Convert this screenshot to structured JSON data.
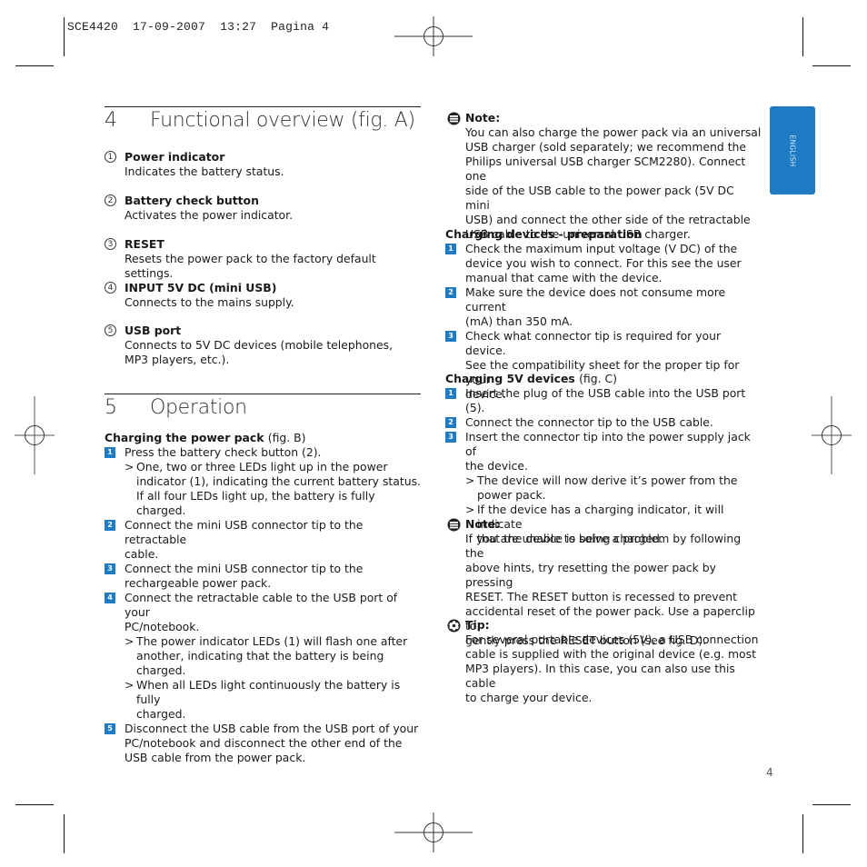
{
  "print_slug": {
    "job": "SCE4420",
    "date": "17-09-2007",
    "time": "13:27",
    "page_label": "Pagina 4"
  },
  "language_tab": {
    "label": "ENGLISH",
    "color": "#1e7bc4"
  },
  "page_number": "4",
  "sections": {
    "functional_overview": {
      "number": "4",
      "title": "Functional overview (fig. A)",
      "items": [
        {
          "marker": "1",
          "label": "Power indicator",
          "description": "Indicates the battery status."
        },
        {
          "marker": "2",
          "label": "Battery check button",
          "description": "Activates the power indicator."
        },
        {
          "marker": "3",
          "label": "RESET",
          "description": "Resets the power pack to the factory default settings."
        },
        {
          "marker": "4",
          "label": "INPUT 5V DC (mini USB)",
          "description": "Connects to the mains supply."
        },
        {
          "marker": "5",
          "label": "USB port",
          "description_lines": [
            "Connects to 5V DC devices (mobile telephones,",
            "MP3 players, etc.)."
          ]
        }
      ]
    },
    "operation": {
      "number": "5",
      "title": "Operation",
      "charging_power_pack": {
        "heading": "Charging the power pack",
        "heading_ref": "(fig. B)",
        "steps": [
          {
            "marker": "1",
            "lines": [
              "Press the battery check button (2)."
            ],
            "results": [
              {
                "lines": [
                  "One, two or three LEDs light up in the power",
                  "indicator (1), indicating the current battery status.",
                  "If all four LEDs light up, the battery is fully charged."
                ]
              }
            ]
          },
          {
            "marker": "2",
            "lines": [
              "Connect the mini USB connector tip to the retractable",
              "cable."
            ]
          },
          {
            "marker": "3",
            "lines": [
              "Connect the mini USB connector tip to the",
              "rechargeable power pack."
            ]
          },
          {
            "marker": "4",
            "lines": [
              "Connect the retractable cable to the USB port of your",
              "PC/notebook."
            ],
            "results": [
              {
                "lines": [
                  "The power indicator LEDs (1) will flash one after",
                  "another, indicating that the battery is being charged."
                ]
              },
              {
                "lines": [
                  "When all LEDs light continuously the battery is fully",
                  "charged."
                ]
              }
            ]
          },
          {
            "marker": "5",
            "lines": [
              "Disconnect the USB cable from the USB port of your",
              "PC/notebook and disconnect the other end of the",
              "USB cable from the power pack."
            ]
          }
        ]
      }
    }
  },
  "right_column": {
    "note1": {
      "icon": "note-icon",
      "heading": "Note:",
      "lines": [
        "You can also charge the power pack via an universal",
        "USB charger (sold separately; we recommend the",
        "Philips universal USB charger SCM2280). Connect one",
        "side of the USB cable to the power pack (5V DC mini",
        "USB) and connect the other side of the retractable",
        "USB cable to the universal USB charger."
      ]
    },
    "preparation": {
      "heading": "Charging devices - preparation",
      "steps": [
        {
          "marker": "1",
          "lines": [
            "Check the maximum input voltage (V DC) of the",
            "device you wish to connect. For this see the user",
            "manual that came with the device."
          ]
        },
        {
          "marker": "2",
          "lines": [
            "Make sure the device does not consume more current",
            "(mA) than 350 mA."
          ]
        },
        {
          "marker": "3",
          "lines": [
            "Check what connector tip is required for your device.",
            "See the compatibility sheet for the proper tip for your",
            "device."
          ]
        }
      ]
    },
    "charging_5v": {
      "heading": "Charging 5V devices",
      "heading_ref": "(fig. C)",
      "steps": [
        {
          "marker": "1",
          "lines": [
            "Insert the plug of the USB cable into the USB port (5)."
          ]
        },
        {
          "marker": "2",
          "lines": [
            "Connect the connector tip to the USB cable."
          ]
        },
        {
          "marker": "3",
          "lines": [
            "Insert the connector tip into the power supply jack of",
            "the device."
          ],
          "results": [
            {
              "lines": [
                "The device will now derive it’s power from the",
                "power pack."
              ]
            },
            {
              "lines": [
                "If the device has a charging indicator, it will indicate",
                "that the device is being charged."
              ]
            }
          ]
        }
      ]
    },
    "note2": {
      "icon": "note-icon",
      "heading": "Note:",
      "lines": [
        "If you are unable to solve a problem by following the",
        "above hints, try resetting the power pack by pressing",
        "RESET. The RESET button is recessed to prevent",
        "accidental reset of the power pack. Use a paperclip to",
        "gently press the RESET button (see fig. D)."
      ]
    },
    "tip": {
      "icon": "tip-icon",
      "heading": "Tip:",
      "lines": [
        "For several portable devices (5V), a USB connection",
        "cable is supplied with the original device (e.g. most",
        "MP3 players). In this case, you can also use this cable",
        "to charge your device."
      ]
    }
  }
}
